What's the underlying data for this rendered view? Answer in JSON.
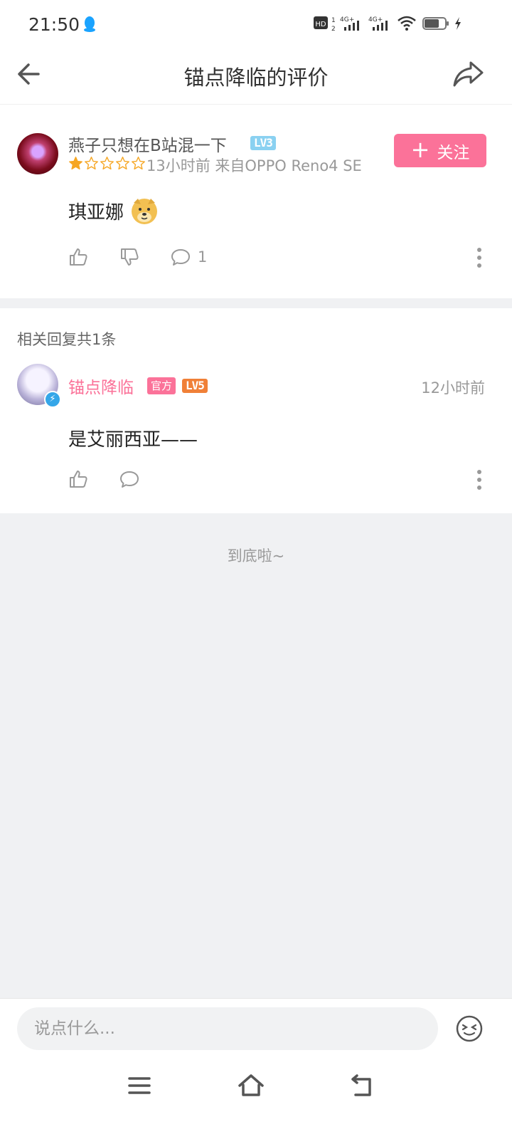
{
  "status_bar": {
    "time": "21:50",
    "icons": [
      "qq-icon",
      "hd-icon",
      "4g-signal-icon",
      "4g-signal-icon",
      "wifi-icon",
      "battery-icon",
      "charging-icon"
    ]
  },
  "header": {
    "title": "锚点降临的评价",
    "back_icon": "arrow-left-icon",
    "share_icon": "share-icon"
  },
  "review": {
    "username": "燕子只想在B站混一下",
    "level": "LV3",
    "rating": 1,
    "rating_max": 5,
    "meta": "13小时前 来自OPPO Reno4 SE",
    "follow_label": "关注",
    "content": "琪亚娜",
    "emoji": "doge-emoji",
    "comment_count": "1"
  },
  "replies": {
    "header": "相关回复共1条",
    "items": [
      {
        "username": "锚点降临",
        "badge": "官方",
        "level": "LV5",
        "time": "12小时前",
        "content": "是艾丽西亚——"
      }
    ]
  },
  "footer": {
    "end_text": "到底啦~"
  },
  "comment_bar": {
    "placeholder": "说点什么..."
  },
  "colors": {
    "accent_pink": "#fb7299",
    "lv3_blue": "#8ad1f1",
    "lv5_orange": "#f08038",
    "star_gold": "#f6a623",
    "background": "#f0f1f3"
  }
}
